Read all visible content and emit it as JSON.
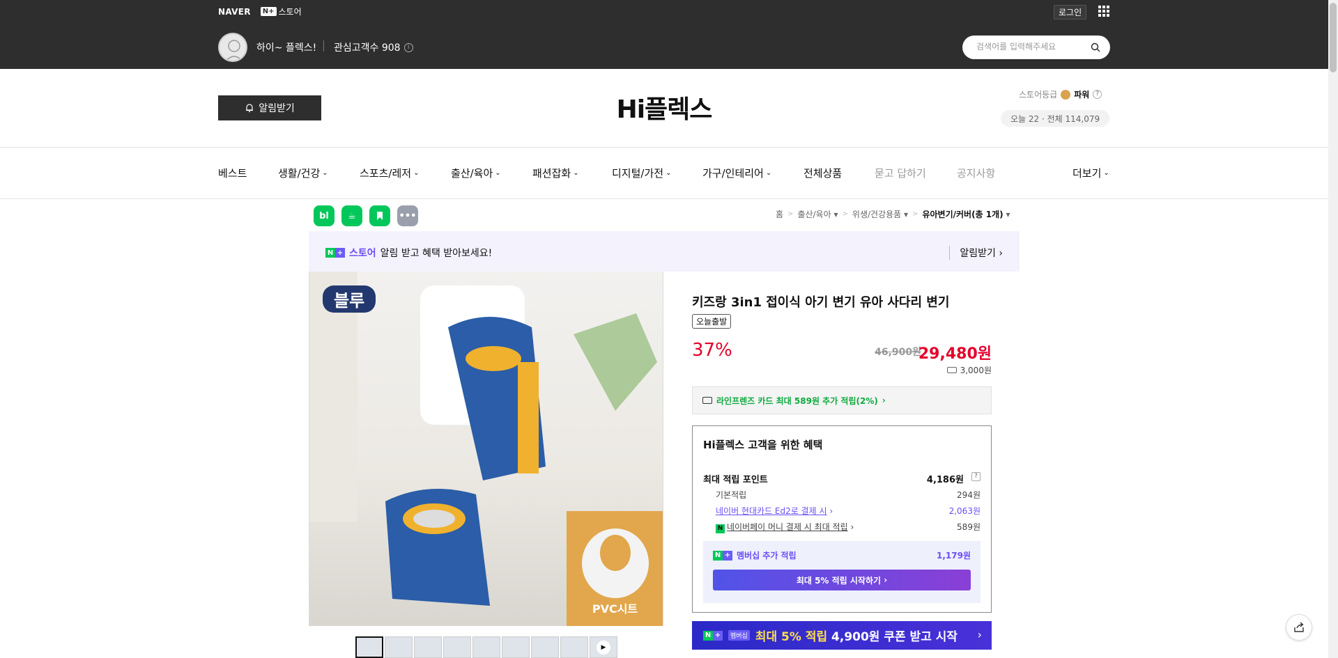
{
  "topbar": {
    "naver_logo": "NAVER",
    "nplus_box": "N+",
    "nplus_label": "스토어",
    "login": "로그인",
    "store_greeting": "하이~ 플렉스!",
    "interest_label": "관심고객수 908",
    "search_placeholder": "검색어를 입력해주세요"
  },
  "header": {
    "alarm_button": "알림받기",
    "store_title": "Hi플렉스",
    "grade_label": "스토어등급",
    "grade_value": "파워",
    "visits": "오늘 22 · 전체 114,079"
  },
  "nav": {
    "items": [
      "베스트",
      "생활/건강",
      "스포츠/레저",
      "출산/육아",
      "패션잡화",
      "디지털/가전",
      "가구/인테리어",
      "전체상품",
      "묻고 답하기",
      "공지사항",
      "더보기"
    ]
  },
  "share_icons": [
    "bl",
    "☕",
    "▶",
    "•••"
  ],
  "breadcrumb": {
    "home": "홈",
    "c1": "출산/육아",
    "c2": "위생/건강용품",
    "c3": "유아변기/커버(총 1개)"
  },
  "promo": {
    "store": "스토어",
    "text": "알림 받고 혜택 받아보세요!",
    "action": "알림받기"
  },
  "image": {
    "badge": "블루",
    "pvc_label": "PVC시트"
  },
  "product": {
    "title": "키즈랑 3in1 접이식 아기 변기 유아 사다리 변기",
    "tag": "오늘출발",
    "discount": "37%",
    "original_price": "46,900원",
    "price": "29,480원",
    "shipping": "3,000원",
    "card_promo": "라인프렌즈 카드 최대 589원 추가 적립(2%)"
  },
  "benefit": {
    "title": "Hi플렉스 고객을 위한 혜택",
    "max_label": "최대 적립 포인트",
    "max_value": "4,186원",
    "basic_label": "기본적립",
    "basic_value": "294원",
    "card_label": "네이버 현대카드 Ed2로 결제 시",
    "card_value": "2,063원",
    "npay_label": "네이버페이 머니 결제 시 최대 적립",
    "npay_value": "589원",
    "membership_label": "멤버십 추가 적립",
    "membership_value": "1,179원",
    "membership_button": "최대 5% 적립 시작하기"
  },
  "bottom_banner": {
    "badge": "멤버십",
    "text_highlight": "최대 5% 적립",
    "text_rest": "4,900원 쿠폰 받고 시작"
  },
  "colors": {
    "topbar": "#2e2e2e",
    "accent_red": "#e4002b",
    "naver_green": "#03c75a",
    "purple": "#6b4df5"
  }
}
